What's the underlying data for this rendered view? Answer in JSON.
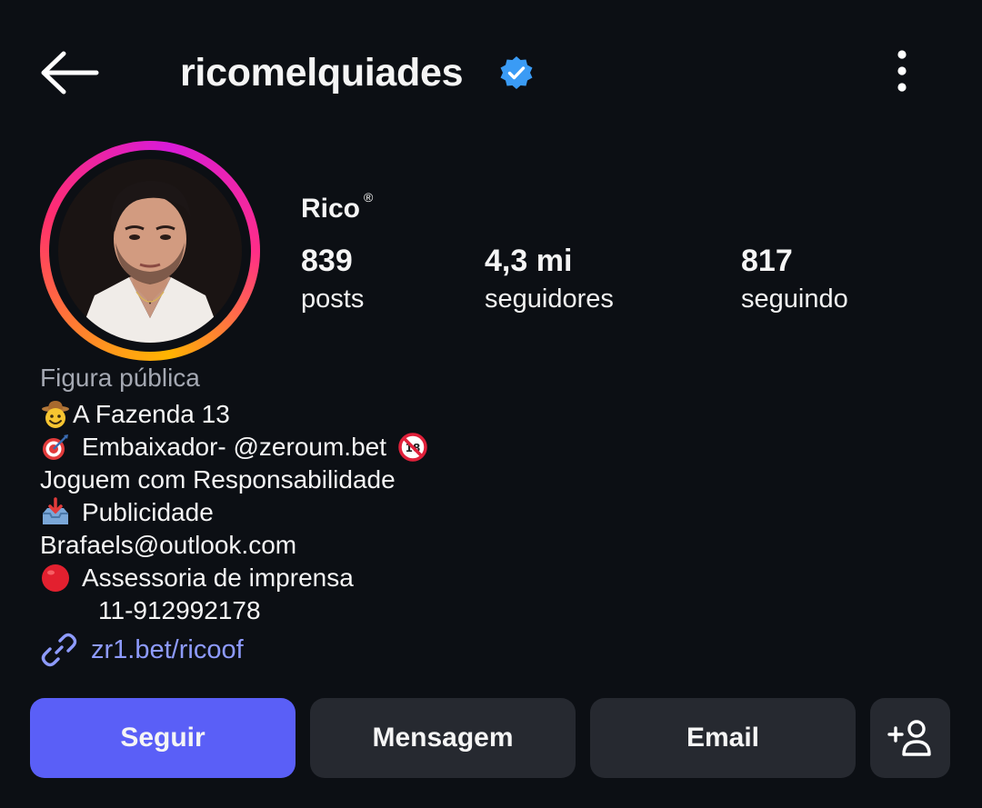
{
  "header": {
    "username": "ricomelquiades",
    "verified": true
  },
  "profile": {
    "display_name": "Rico",
    "name_mark": "®",
    "stats": {
      "posts": {
        "value": "839",
        "label": "posts"
      },
      "followers": {
        "value": "4,3 mi",
        "label": "seguidores"
      },
      "following": {
        "value": "817",
        "label": "seguindo"
      }
    },
    "category": "Figura pública",
    "bio": [
      {
        "emoji": "cowboy-face",
        "text": "A Fazenda 13"
      },
      {
        "emoji": "direct-hit-dart",
        "text": "Embaixador- @zeroum.bet",
        "trailing_emoji": "no-one-under-18"
      },
      {
        "emoji": "",
        "text": "Joguem com Responsabilidade"
      },
      {
        "emoji": "inbox-tray",
        "text": "Publicidade"
      },
      {
        "emoji": "",
        "text": "Brafaels@outlook.com"
      },
      {
        "emoji": "red-circle",
        "text": "Assessoria de imprensa"
      },
      {
        "emoji": "",
        "text": "11-912992178"
      }
    ],
    "link": "zr1.bet/ricoof"
  },
  "actions": {
    "follow": "Seguir",
    "message": "Mensagem",
    "email": "Email",
    "add_user_icon": "add-person-icon"
  },
  "colors": {
    "background": "#0c0f14",
    "follow_button": "#5a5ff7",
    "secondary_button": "#262930",
    "link": "#8e9bff",
    "verified_badge": "#3a9bf5",
    "muted_text": "#a4a8b2"
  }
}
